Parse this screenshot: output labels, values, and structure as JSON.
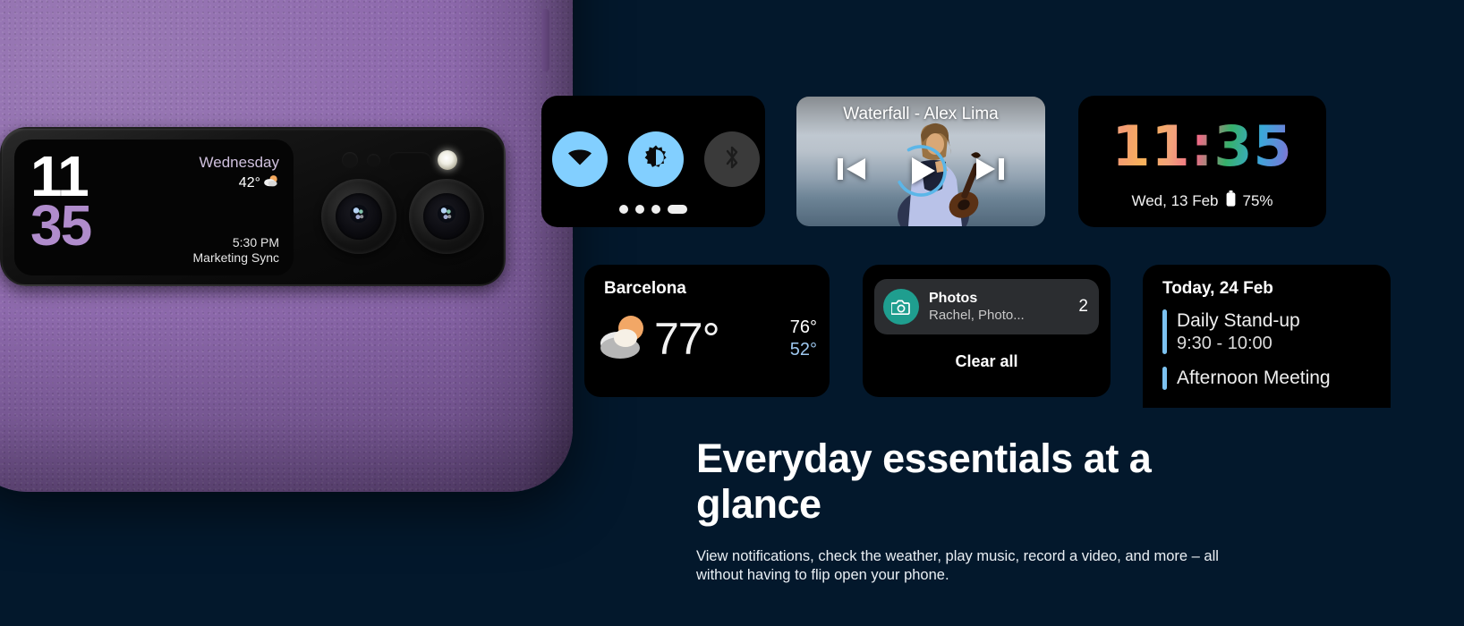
{
  "background_color": "#03182c",
  "phone": {
    "body_color": "#8e6aad",
    "material": "vegan-leather-texture",
    "cover_screen": {
      "time_hours": "11",
      "time_minutes": "35",
      "hours_color": "#ffffff",
      "minutes_color": "#b08ccc",
      "day": "Wednesday",
      "temperature": "42°",
      "weather_icon": "partly-cloudy-icon",
      "appointment_time": "5:30 PM",
      "appointment_title": "Marketing Sync"
    },
    "camera": {
      "lenses": 2,
      "flash": "led-flash",
      "sensors": 3
    }
  },
  "widgets": {
    "quick_settings": {
      "name": "quick-settings",
      "toggles": [
        {
          "icon": "wifi-icon",
          "label": "Wi-Fi",
          "state": "on",
          "color": "#82cfff"
        },
        {
          "icon": "brightness-icon",
          "label": "Brightness",
          "state": "on",
          "color": "#82cfff"
        },
        {
          "icon": "bluetooth-icon",
          "label": "Bluetooth",
          "state": "off",
          "color": "#3a3a3a"
        }
      ],
      "page_dots": 4,
      "active_dot": 4
    },
    "media": {
      "name": "media-player",
      "track_title": "Waterfall - Alex Lima",
      "previous_label": "Previous",
      "play_label": "Play",
      "next_label": "Next",
      "progress_color": "#5bb6e8"
    },
    "clock": {
      "name": "clock",
      "time": "11:35",
      "date": "Wed, 13 Feb",
      "battery": "75%",
      "battery_icon": "battery-icon"
    },
    "weather": {
      "name": "weather",
      "city": "Barcelona",
      "current_temp": "77°",
      "high": "76°",
      "low": "52°",
      "condition_icon": "partly-cloudy-icon",
      "low_color": "#9ec8f0"
    },
    "notifications": {
      "name": "notifications",
      "app_name": "Photos",
      "summary": "Rachel, Photo...",
      "count": "2",
      "app_icon": "camera-icon",
      "app_icon_color": "#1f9e8f",
      "clear_all_label": "Clear all"
    },
    "calendar": {
      "name": "calendar",
      "header": "Today, 24 Feb",
      "accent_color": "#7cc2f0",
      "events": [
        {
          "name": "Daily Stand-up",
          "time": "9:30 - 10:00"
        },
        {
          "name": "Afternoon Meeting",
          "time": ""
        }
      ]
    }
  },
  "copy": {
    "headline": "Everyday essentials at a glance",
    "body": "View notifications, check the weather, play music, record a video, and more – all without having to flip open your phone."
  }
}
